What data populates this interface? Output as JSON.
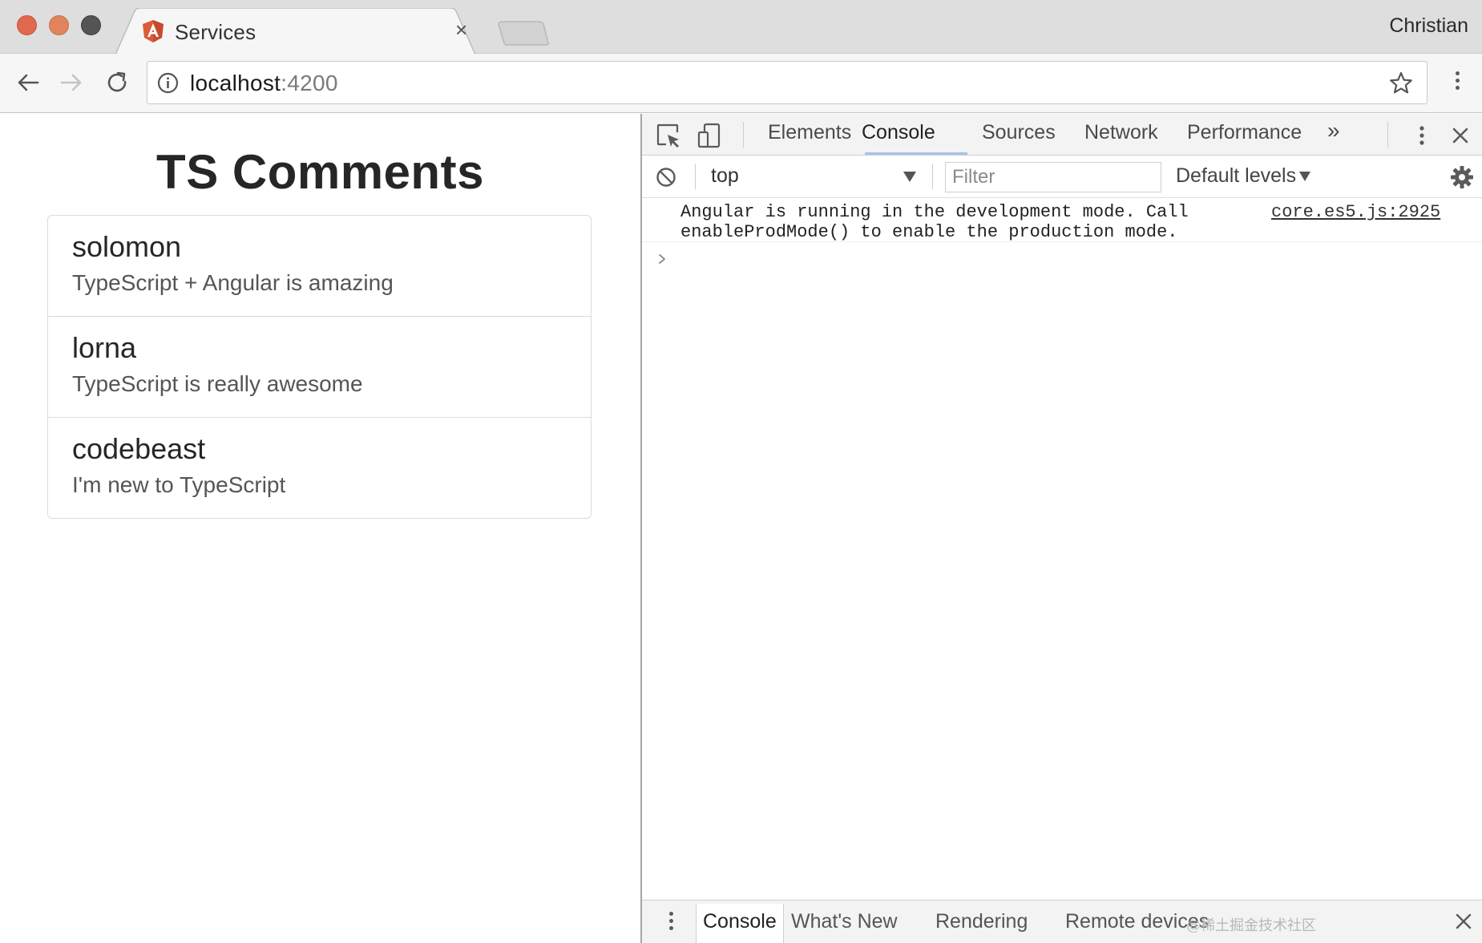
{
  "browser": {
    "tab": {
      "title": "Services",
      "favicon": "angular-icon",
      "close_icon": "×"
    },
    "profile_name": "Christian",
    "address": {
      "host": "localhost",
      "port": ":4200"
    }
  },
  "page": {
    "title": "TS Comments",
    "comments": [
      {
        "author": "solomon",
        "text": "TypeScript + Angular is amazing"
      },
      {
        "author": "lorna",
        "text": "TypeScript is really awesome"
      },
      {
        "author": "codebeast",
        "text": "I'm new to TypeScript"
      }
    ]
  },
  "devtools": {
    "tabs": [
      "Elements",
      "Console",
      "Sources",
      "Network",
      "Performance"
    ],
    "active_tab": "Console",
    "more_tabs_glyph": "»",
    "context": "top",
    "filter_placeholder": "Filter",
    "levels": "Default levels",
    "messages": [
      {
        "text": "Angular is running in the development mode. Call\nenableProdMode() to enable the production mode.",
        "source": "core.es5.js:2925"
      }
    ],
    "drawer_tabs": [
      "Console",
      "What's New",
      "Rendering",
      "Remote devices"
    ],
    "drawer_active": "Console"
  },
  "watermark": "@稀土掘金技术社区",
  "colors": {
    "close_light": "#e0684f",
    "minimize_light": "#e1845c",
    "maximize_light": "#545454",
    "angular_red": "#c3002f",
    "active_tab_underline": "#a8c1ec"
  }
}
